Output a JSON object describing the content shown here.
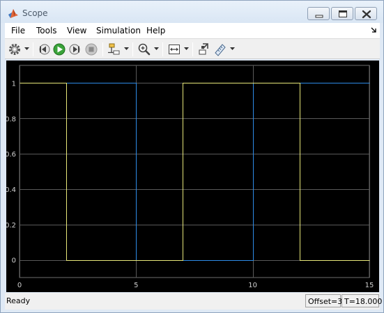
{
  "window": {
    "title": "Scope",
    "icon": "matlab-icon",
    "controls": [
      "minimize-icon",
      "maximize-icon",
      "close-icon"
    ]
  },
  "menu": {
    "items": [
      "File",
      "Tools",
      "View",
      "Simulation",
      "Help"
    ],
    "overflow_icon": "undock-arrow-icon"
  },
  "toolbar": {
    "icons": [
      "settings-icon",
      "step-back-icon",
      "run-icon",
      "step-forward-icon",
      "stop-icon",
      "signal-selector-icon",
      "zoom-icon",
      "autoscale-icon",
      "highlight-block-icon",
      "measurements-icon"
    ]
  },
  "status": {
    "state": "Ready",
    "offset": "Offset=3",
    "time": "T=18.000"
  },
  "colors": {
    "plot_background": "#000000",
    "axes_background": "#000000",
    "grid": "#5a5a5a",
    "series_blue": "#2e8ce8",
    "series_yellow": "#e8e87a"
  },
  "chart_data": {
    "type": "line",
    "title": "",
    "xlabel": "",
    "ylabel": "",
    "xlim": [
      0,
      15
    ],
    "ylim": [
      -0.1,
      1.1
    ],
    "xticks": [
      0,
      5,
      10,
      15
    ],
    "xtick_labels": [
      "0",
      "5",
      "10",
      "15"
    ],
    "yticks": [
      0,
      0.2,
      0.4,
      0.6,
      0.8,
      1
    ],
    "ytick_labels": [
      "0",
      "0.2",
      "0.4",
      "0.6",
      "0.8",
      "1"
    ],
    "grid": true,
    "series": [
      {
        "color": "#2e8ce8",
        "x": [
          0,
          5,
          5,
          10,
          10,
          15
        ],
        "y": [
          1,
          1,
          0,
          0,
          1,
          1
        ]
      },
      {
        "color": "#e8e87a",
        "x": [
          0,
          2,
          2,
          7,
          7,
          10,
          10,
          12,
          12,
          15
        ],
        "y": [
          1,
          1,
          0,
          0,
          1,
          1,
          1,
          1,
          0,
          0
        ]
      }
    ]
  }
}
